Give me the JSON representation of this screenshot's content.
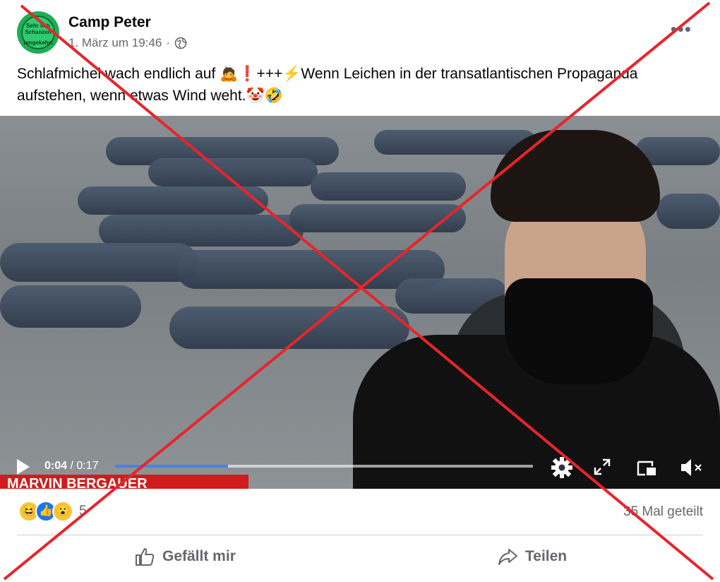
{
  "post": {
    "page_name": "Camp Peter",
    "timestamp": "1. März um 19:46",
    "audience_icon": "globe-icon",
    "more_label": "•••",
    "text_line1": "Schlafmichel wach endlich auf 🙇❗+++⚡Wenn Leichen in der transatlantischen Propaganda",
    "text_line2": "aufstehen, wenn etwas Wind weht.🤡🤣"
  },
  "avatar": {
    "text_top": "Sehr lieb Schanzen",
    "text_bottom": "umgekehrt"
  },
  "video": {
    "current_time": "0:04",
    "separator": " / ",
    "duration": "0:17",
    "progress": 0.27,
    "lower_third": "MARVIN BERGAUER",
    "controls": [
      "settings-icon",
      "fullscreen-icon",
      "picture-in-picture-icon",
      "mute-icon"
    ]
  },
  "reactions": {
    "icons": [
      "haha-icon",
      "like-icon",
      "wow-icon"
    ],
    "count": "5",
    "shares": "35 Mal geteilt"
  },
  "actions": {
    "like_label": "Gefällt mir",
    "share_label": "Teilen"
  },
  "colors": {
    "accent": "#1877f2",
    "progress": "#4a7fe6",
    "cross": "#e8242c",
    "lower_third": "#d01c1c"
  }
}
